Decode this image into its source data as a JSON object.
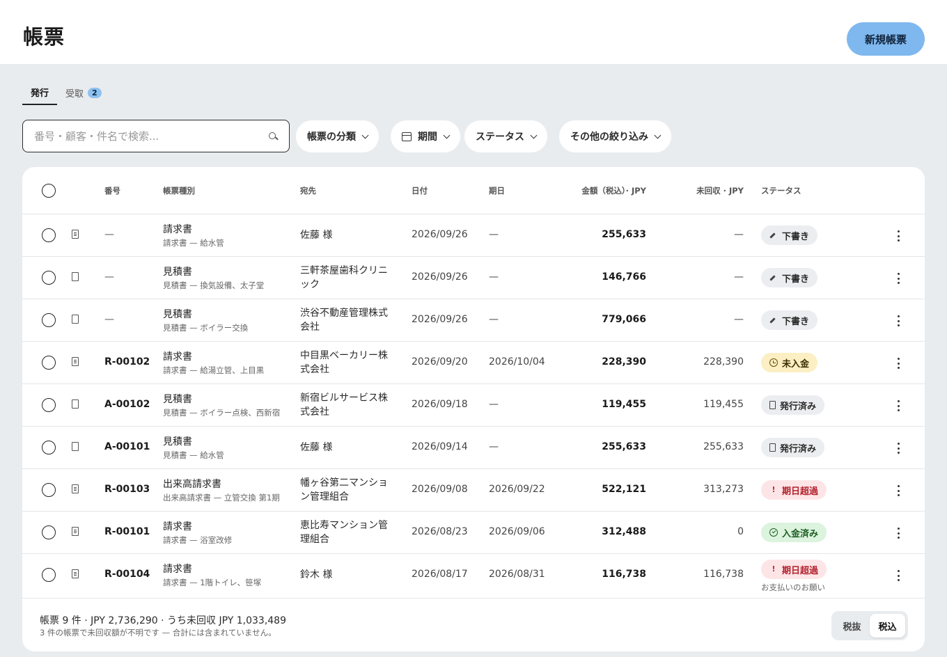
{
  "header": {
    "title": "帳票",
    "new_button": "新規帳票"
  },
  "tabs": [
    {
      "label": "発行",
      "active": true
    },
    {
      "label": "受取",
      "badge": "2"
    }
  ],
  "search": {
    "placeholder": "番号・顧客・件名で検索..."
  },
  "filters": [
    "帳票の分類",
    "期間",
    "ステータス",
    "その他の絞り込み"
  ],
  "columns": {
    "number": "番号",
    "kind": "帳票種別",
    "dest": "宛先",
    "date": "日付",
    "due": "期日",
    "amount": "金額（税込）· JPY",
    "unpaid": "未回収 · JPY",
    "status": "ステータス"
  },
  "rows": [
    {
      "number": "—",
      "kind": "請求書",
      "subject": "請求書 — 給水管",
      "dest": "佐藤 様",
      "date": "2026/09/26",
      "due": "—",
      "amount": "255,633",
      "unpaid": "—",
      "status": "下書き",
      "status_type": "draft",
      "icon": "invoice"
    },
    {
      "number": "—",
      "kind": "見積書",
      "subject": "見積書 — 換気設備、太子堂",
      "dest": "三軒茶屋歯科クリニック",
      "date": "2026/09/26",
      "due": "—",
      "amount": "146,766",
      "unpaid": "—",
      "status": "下書き",
      "status_type": "draft",
      "icon": "quote"
    },
    {
      "number": "—",
      "kind": "見積書",
      "subject": "見積書 — ボイラー交換",
      "dest": "渋谷不動産管理株式会社",
      "date": "2026/09/26",
      "due": "—",
      "amount": "779,066",
      "unpaid": "—",
      "status": "下書き",
      "status_type": "draft",
      "icon": "quote"
    },
    {
      "number": "R-00102",
      "kind": "請求書",
      "subject": "請求書 — 給湯立管、上目黒",
      "dest": "中目黒ベーカリー株式会社",
      "date": "2026/09/20",
      "due": "2026/10/04",
      "amount": "228,390",
      "unpaid": "228,390",
      "status": "未入金",
      "status_type": "unpaid",
      "icon": "invoice"
    },
    {
      "number": "A-00102",
      "kind": "見積書",
      "subject": "見積書 — ボイラー点検、西新宿",
      "dest": "新宿ビルサービス株式会社",
      "date": "2026/09/18",
      "due": "—",
      "amount": "119,455",
      "unpaid": "119,455",
      "status": "発行済み",
      "status_type": "issued",
      "icon": "quote"
    },
    {
      "number": "A-00101",
      "kind": "見積書",
      "subject": "見積書 — 給水管",
      "dest": "佐藤 様",
      "date": "2026/09/14",
      "due": "—",
      "amount": "255,633",
      "unpaid": "255,633",
      "status": "発行済み",
      "status_type": "issued",
      "icon": "quote"
    },
    {
      "number": "R-00103",
      "kind": "出来高請求書",
      "subject": "出来高請求書 — 立管交換 第1期",
      "dest": "幡ヶ谷第二マンション管理組合",
      "date": "2026/09/08",
      "due": "2026/09/22",
      "amount": "522,121",
      "unpaid": "313,273",
      "status": "期日超過",
      "status_type": "overdue",
      "icon": "invoice"
    },
    {
      "number": "R-00101",
      "kind": "請求書",
      "subject": "請求書 — 浴室改修",
      "dest": "恵比寿マンション管理組合",
      "date": "2026/08/23",
      "due": "2026/09/06",
      "amount": "312,488",
      "unpaid": "0",
      "status": "入金済み",
      "status_type": "paid",
      "icon": "invoice"
    },
    {
      "number": "R-00104",
      "kind": "請求書",
      "subject": "請求書 — 1階トイレ、笹塚",
      "dest": "鈴木 様",
      "date": "2026/08/17",
      "due": "2026/08/31",
      "amount": "116,738",
      "unpaid": "116,738",
      "status": "期日超過",
      "status_type": "overdue",
      "status_note": "お支払いのお願い",
      "icon": "invoice"
    }
  ],
  "footer": {
    "summary": "帳票 9 件 · JPY 2,736,290 · うち未回収 JPY 1,033,489",
    "note": "3 件の帳票で未回収額が不明です — 合計には含まれていません。",
    "toggle": [
      "税抜",
      "税込"
    ],
    "toggle_selected": "税込"
  },
  "colors": {
    "accent": "#7fb8ef",
    "overdue": "#b3202c",
    "paid": "#1b5e23",
    "unpaid": "#fbefc3"
  }
}
